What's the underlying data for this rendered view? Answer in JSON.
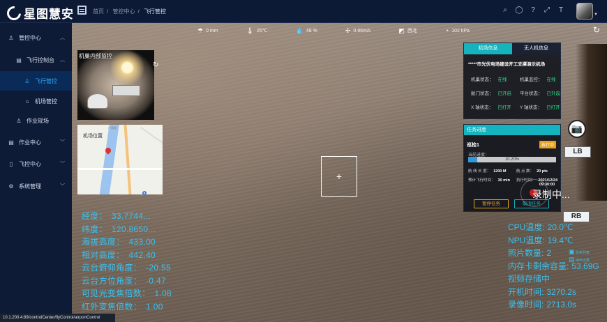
{
  "header": {
    "logo_text": "星图慧安",
    "breadcrumb": [
      "首页",
      "管控中心",
      "飞行管控"
    ],
    "icons": [
      "search-icon",
      "github-icon",
      "help-icon",
      "fullscreen-icon",
      "font-size-icon"
    ]
  },
  "sidebar": {
    "items": [
      {
        "label": "管控中心",
        "icon": "person-icon",
        "arrow": "^"
      },
      {
        "label": "飞行控制台",
        "icon": "document-icon",
        "arrow": "^"
      },
      {
        "label": "飞行管控",
        "icon": "person-icon"
      },
      {
        "label": "机场管控",
        "icon": "home-icon"
      },
      {
        "label": "作业现场",
        "icon": "person-icon"
      },
      {
        "label": "作业中心",
        "icon": "document-icon",
        "arrow": "v"
      },
      {
        "label": "飞控中心",
        "icon": "doc-icon",
        "arrow": "v"
      },
      {
        "label": "系统管理",
        "icon": "gear-icon",
        "arrow": "v"
      }
    ]
  },
  "weather": {
    "rain": "0 mm",
    "temperature": "25℃",
    "humidity": "48 %",
    "wind_speed": "0.96m/s",
    "wind_direction": "西北",
    "pressure": "102 kPa"
  },
  "hangar_cam": {
    "title": "机巢内部监控"
  },
  "map": {
    "title": "机场位置",
    "small_label": "广顺路"
  },
  "crosshair": "+",
  "telemetry": [
    {
      "label": "经度：",
      "value": "33.7744..."
    },
    {
      "label": "纬度：",
      "value": "120.8650..."
    },
    {
      "label": "海拔高度：",
      "value": "433.00"
    },
    {
      "label": "相对高度：",
      "value": "442.40"
    },
    {
      "label": "云台俯仰角度：",
      "value": "-20.55"
    },
    {
      "label": "云台方位角度：",
      "value": "-0.47"
    },
    {
      "label": "可见光变焦倍数：",
      "value": "1.08"
    },
    {
      "label": "红外变焦倍数：",
      "value": "1.00"
    }
  ],
  "airport_panel": {
    "tab_airport": "机场信息",
    "tab_uav": "无人机信息",
    "name": "*****市光伏电场建设开工支撑演示机场",
    "status": [
      {
        "label": "机巢状态：",
        "value": "在线"
      },
      {
        "label": "机巢监控：",
        "value": "在线"
      },
      {
        "label": "舱门状态：",
        "value": "已开启"
      },
      {
        "label": "平台状态：",
        "value": "已升起"
      },
      {
        "label": "X 轴状态：",
        "value": "已打开"
      },
      {
        "label": "Y 轴状态：",
        "value": "已打开"
      }
    ],
    "status_color": "#2fdd83"
  },
  "task_panel": {
    "header": "任务进度",
    "task_name": "巡检1",
    "badge": "执行中",
    "progress_label": "当前进度：",
    "progress_text": "10.20%",
    "progress_value": 10.2,
    "route_length_label": "航 线 长 度：",
    "route_length": "1200 M",
    "waypoints_label": "航 点 数：",
    "waypoints": "20 pts",
    "est_time_label": "预计飞行时间：",
    "est_time": "30 min",
    "exec_time_label": "执行时间：",
    "exec_time_date": "2021/12/24",
    "exec_time_clock": "09:30:00",
    "pause_button": "暂停任务",
    "cancel_button": "取消任务"
  },
  "controls": {
    "lb": "LB",
    "rb": "RB",
    "recording": "录制中..."
  },
  "device": [
    {
      "label": "CPU温度:",
      "value": "20.0℃"
    },
    {
      "label": "NPU温度:",
      "value": "19.4℃"
    },
    {
      "label": "照片数量:",
      "value": "2"
    },
    {
      "label": "内存卡剩余容量:",
      "value": "53.69G"
    },
    {
      "label": "视频存储中",
      "value": ""
    },
    {
      "label": "开机时间:",
      "value": "3270.2s"
    },
    {
      "label": "录像时间:",
      "value": "2713.0s"
    }
  ],
  "side_icons": {
    "task_list": "任务列表",
    "op_record": "操作记录"
  },
  "statusbar": {
    "url": "10.1.200.4:89/controlCenter/flyControl/airportControl"
  },
  "colors": {
    "accent": "#14b3bd",
    "active_blue": "#2fa8ff",
    "telemetry": "#39c1f0",
    "warning": "#e8a21a"
  }
}
